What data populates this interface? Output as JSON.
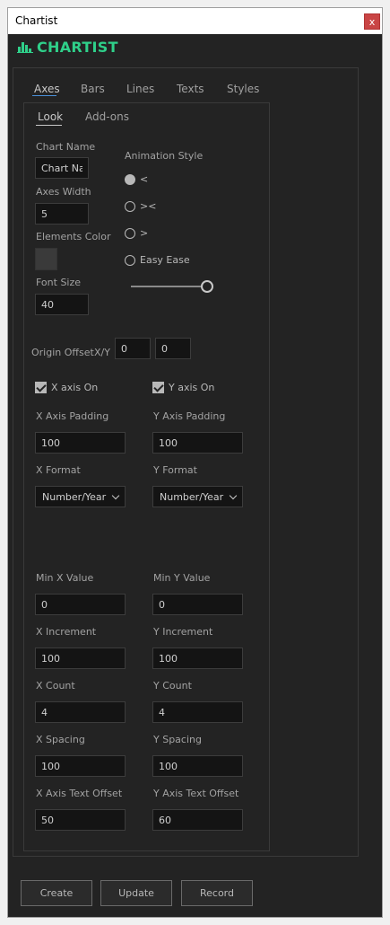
{
  "window": {
    "title": "Chartist",
    "close_label": "x"
  },
  "logo": {
    "text": "CHARTIST",
    "icon": "bar-chart-icon"
  },
  "tabs": [
    {
      "label": "Axes",
      "active": true
    },
    {
      "label": "Bars",
      "active": false
    },
    {
      "label": "Lines",
      "active": false
    },
    {
      "label": "Texts",
      "active": false
    },
    {
      "label": "Styles",
      "active": false
    }
  ],
  "subtabs": [
    {
      "label": "Look",
      "active": true
    },
    {
      "label": "Add-ons",
      "active": false
    }
  ],
  "look": {
    "chart_name_label": "Chart Name",
    "chart_name_value": "Chart Nam",
    "axes_width_label": "Axes Width",
    "axes_width_value": "5",
    "elements_color_label": "Elements Color",
    "font_size_label": "Font Size",
    "font_size_value": "40",
    "animation_style_label": "Animation Style",
    "animation_options": [
      {
        "label": "<",
        "checked": true
      },
      {
        "label": "><",
        "checked": false
      },
      {
        "label": ">",
        "checked": false
      },
      {
        "label": "Easy Ease",
        "checked": false
      }
    ],
    "animation_slider_value": 1.0
  },
  "origin": {
    "label": "Origin Offset",
    "xy_label": "X/Y",
    "x_value": "0",
    "y_value": "0"
  },
  "x_axis": {
    "on_label": "X axis On",
    "on": true,
    "padding_label": "X Axis Padding",
    "padding_value": "100",
    "format_label": "X Format",
    "format_value": "Number/Year",
    "min_label": "Min X Value",
    "min_value": "0",
    "increment_label": "X Increment",
    "increment_value": "100",
    "count_label": "X Count",
    "count_value": "4",
    "spacing_label": "X Spacing",
    "spacing_value": "100",
    "text_offset_label": "X Axis Text Offset",
    "text_offset_value": "50"
  },
  "y_axis": {
    "on_label": "Y axis On",
    "on": true,
    "padding_label": "Y Axis Padding",
    "padding_value": "100",
    "format_label": "Y Format",
    "format_value": "Number/Year",
    "min_label": "Min Y Value",
    "min_value": "0",
    "increment_label": "Y Increment",
    "increment_value": "100",
    "count_label": "Y Count",
    "count_value": "4",
    "spacing_label": "Y Spacing",
    "spacing_value": "100",
    "text_offset_label": "Y Axis Text Offset",
    "text_offset_value": "60"
  },
  "buttons": {
    "create": "Create",
    "update": "Update",
    "record": "Record"
  },
  "colors": {
    "accent": "#2fd08a",
    "background": "#232323",
    "field": "#141414",
    "swatch": "#3a3a3a"
  }
}
